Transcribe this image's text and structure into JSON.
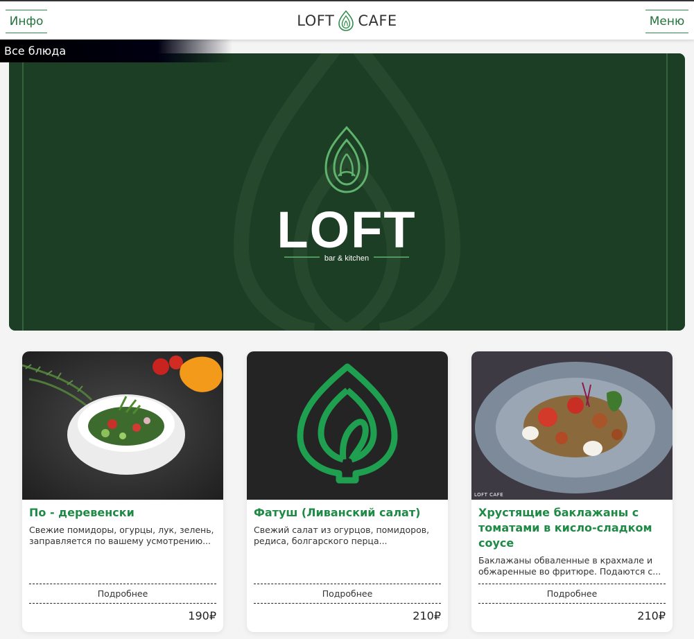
{
  "header": {
    "info_label": "Инфо",
    "menu_label": "Меню",
    "brand_left": "LOFT",
    "brand_right": "CAFE"
  },
  "category": {
    "label": "Все блюда"
  },
  "banner": {
    "logo_text": "LOFT",
    "logo_subtitle": "bar & kitchen"
  },
  "colors": {
    "accent": "#1e8a45",
    "banner_bg": "#1c3e24",
    "icon_green": "#1fa050"
  },
  "cards": [
    {
      "title": "По - деревенски",
      "description": "Свежие помидоры, огурцы, лук, зелень, заправляется по вашему усмотрению...",
      "more_label": "Подробнее",
      "price": "190₽"
    },
    {
      "title": "Фатуш (Ливанский салат)",
      "description": "Свежий салат из огурцов, помидоров, редиса, болгарского перца...",
      "more_label": "Подробнее",
      "price": "210₽"
    },
    {
      "title": "Хрустящие баклажаны с томатами в кисло-сладком соусе",
      "description": "Баклажаны обваленные в крахмале и обжаренные во фритюре. Подаются с...",
      "more_label": "Подробнее",
      "price": "210₽",
      "watermark": "LOFT  CAFE"
    }
  ]
}
